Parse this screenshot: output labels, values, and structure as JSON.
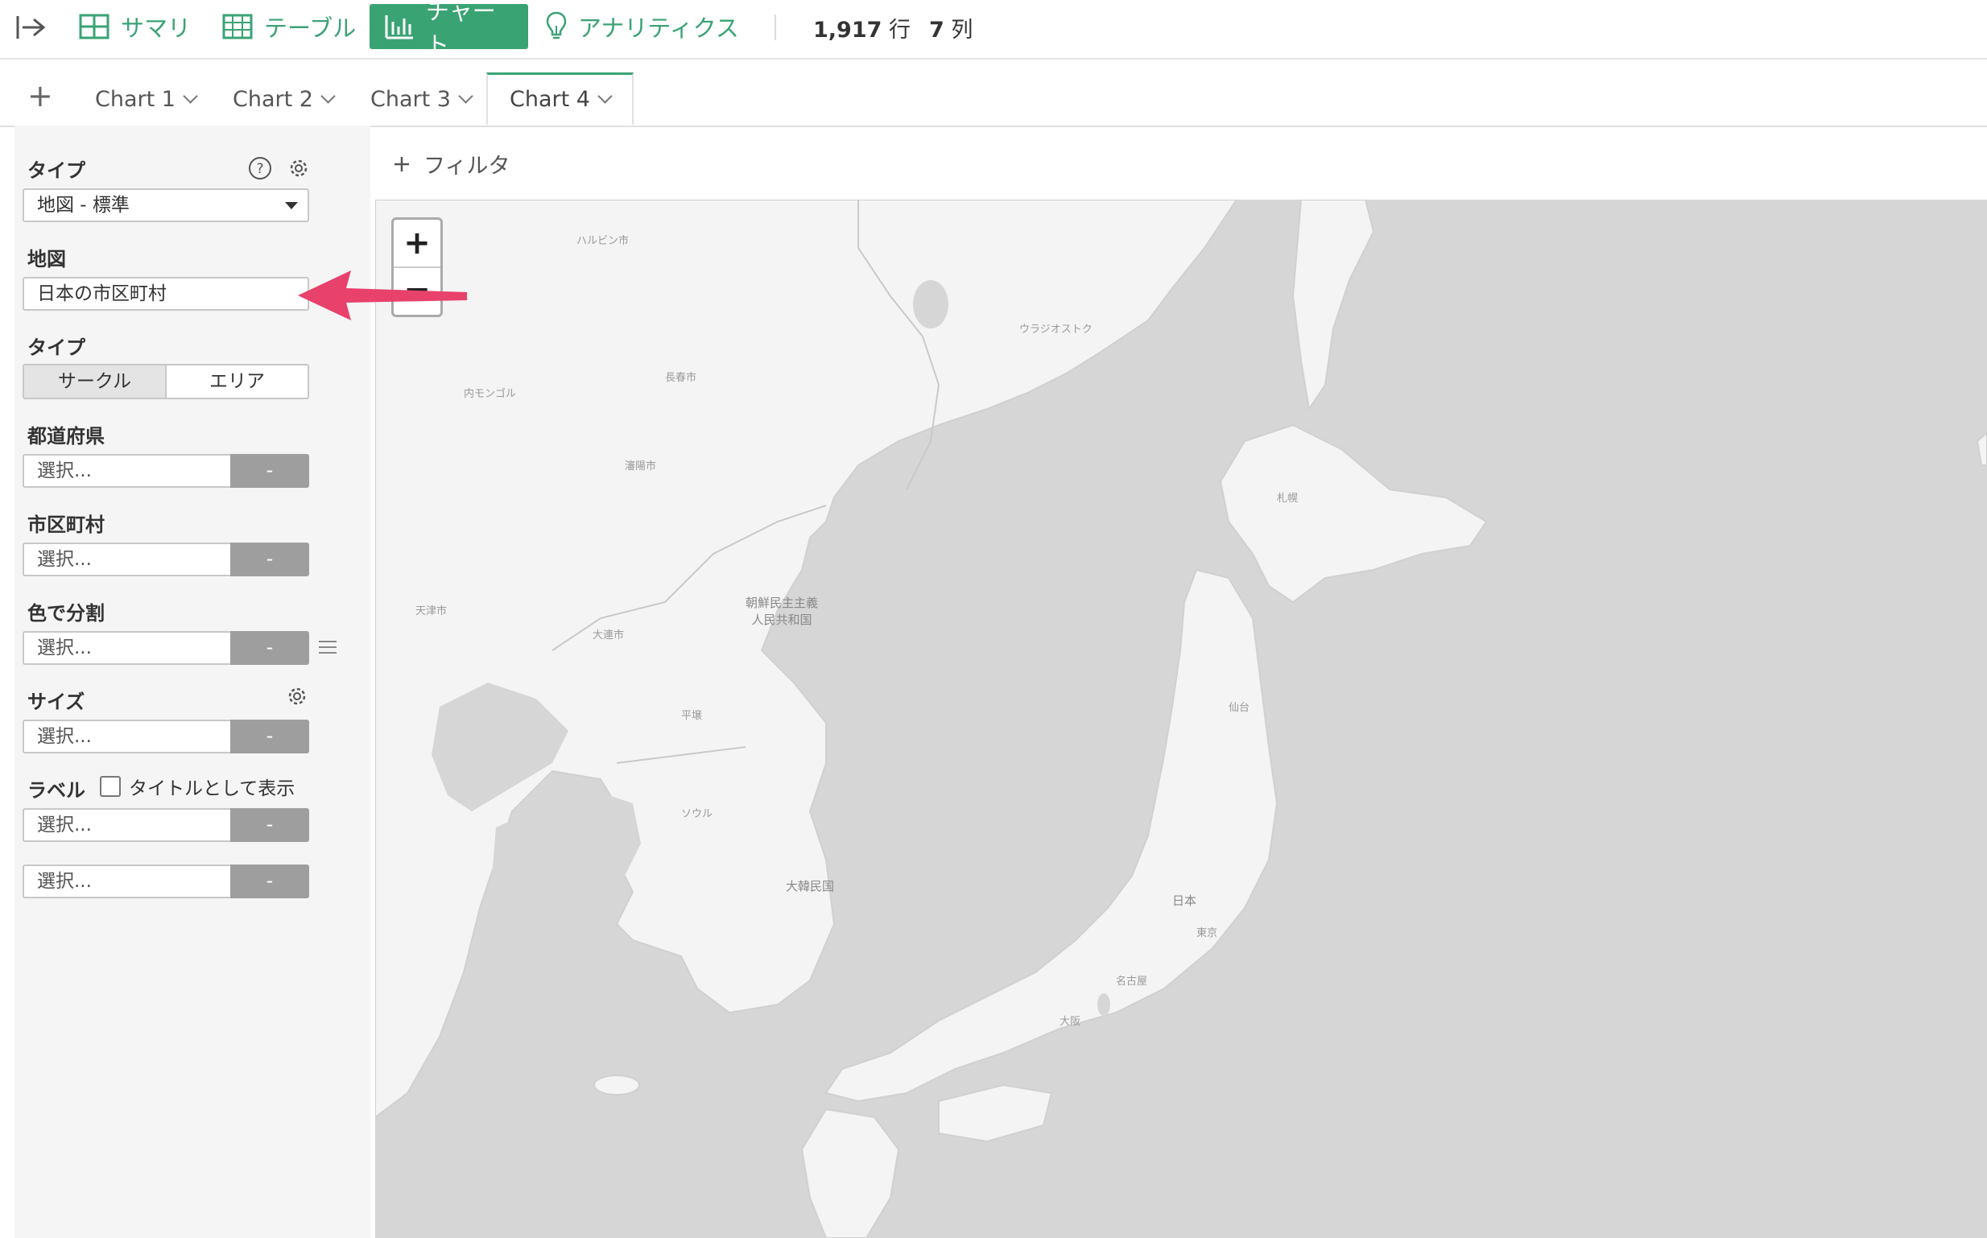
{
  "toolbar": {
    "summary_label": "サマリ",
    "table_label": "テーブル",
    "chart_label": "チャート",
    "analytics_label": "アナリティクス",
    "rows_count": "1,917",
    "rows_unit": "行",
    "cols_count": "7",
    "cols_unit": "列",
    "accent_color": "#3aa374"
  },
  "tabs": {
    "add_label": "+",
    "items": [
      {
        "label": "Chart 1",
        "active": false
      },
      {
        "label": "Chart 2",
        "active": false
      },
      {
        "label": "Chart 3",
        "active": false
      },
      {
        "label": "Chart 4",
        "active": true
      }
    ]
  },
  "sidebar": {
    "type_label": "タイプ",
    "type_value": "地図 - 標準",
    "map_label": "地図",
    "map_value": "日本の市区町村",
    "subtype_label": "タイプ",
    "subtype_options": [
      "サークル",
      "エリア"
    ],
    "subtype_selected": "サークル",
    "prefecture_label": "都道府県",
    "city_label": "市区町村",
    "color_label": "色で分割",
    "size_label": "サイズ",
    "label_label": "ラベル",
    "show_as_title_label": "タイトルとして表示",
    "show_as_title_checked": false,
    "select_placeholder": "選択...",
    "remove_button_label": "-"
  },
  "filter": {
    "add_label": "フィルタ"
  },
  "map": {
    "zoom_in_label": "+",
    "zoom_out_label": "−",
    "labels": {
      "harbin": "ハルビン市",
      "chinese_city_1": "長春市",
      "dprk": "朝鮮民主主義人民共和国",
      "seoul": "ソウル",
      "korea": "大韓民国",
      "japan": "日本",
      "tokyo": "東京",
      "vladivostok": "ウラジオストク",
      "sapporo": "札幌",
      "tianjin": "天津市",
      "inner_mongolia": "内モンゴル",
      "chinese_city_2": "大連市",
      "chinese_city_3": "瀋陽市",
      "pyongyang": "平壌",
      "nagoya": "名古屋",
      "osaka": "大阪",
      "sendai": "仙台"
    },
    "land_color": "#f4f4f4",
    "water_color": "#d6d6d6"
  },
  "annotation_arrow_color": "#e8416c"
}
